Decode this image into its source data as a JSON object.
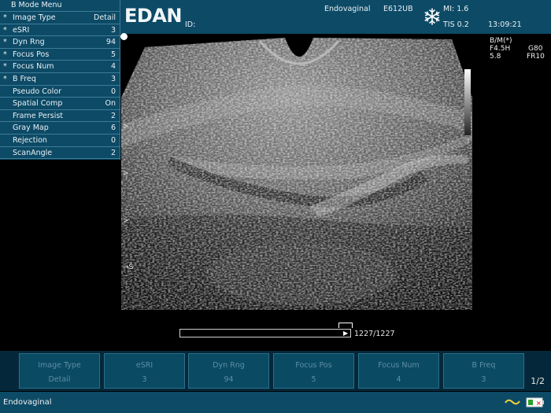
{
  "menu": {
    "title": "B Mode Menu",
    "items": [
      {
        "star": "*",
        "label": "Image Type",
        "value": "Detail"
      },
      {
        "star": "*",
        "label": "eSRI",
        "value": "3"
      },
      {
        "star": "*",
        "label": "Dyn Rng",
        "value": "94"
      },
      {
        "star": "*",
        "label": "Focus Pos",
        "value": "5"
      },
      {
        "star": "*",
        "label": "Focus Num",
        "value": "4"
      },
      {
        "star": "*",
        "label": "B Freq",
        "value": "3"
      },
      {
        "star": "",
        "label": "Pseudo Color",
        "value": "0"
      },
      {
        "star": "",
        "label": "Spatial Comp",
        "value": "On"
      },
      {
        "star": "",
        "label": "Frame Persist",
        "value": "2"
      },
      {
        "star": "",
        "label": "Gray Map",
        "value": "6"
      },
      {
        "star": "",
        "label": "Rejection",
        "value": "0"
      },
      {
        "star": "",
        "label": "ScanAngle",
        "value": "2"
      }
    ]
  },
  "header": {
    "logo": "EDAN",
    "id_label": "ID:",
    "probe_mode": "Endovaginal",
    "probe_name": "E612UB",
    "freeze_icon": "snowflake-icon",
    "mi": "MI: 1.6",
    "tis": "TIS 0.2",
    "time": "13:09:21"
  },
  "params": {
    "mode": "B/M(*)",
    "freq": "F4.5H",
    "gain": "G80",
    "depth": "5.8",
    "frame_rate": "FR10"
  },
  "depth_markers": [
    ">",
    ">",
    ">",
    "→S"
  ],
  "cine": {
    "frame": "1227/1227",
    "progress": 1.0
  },
  "softkeys": [
    {
      "label": "Image Type",
      "value": "Detail"
    },
    {
      "label": "eSRI",
      "value": "3"
    },
    {
      "label": "Dyn Rng",
      "value": "94"
    },
    {
      "label": "Focus Pos",
      "value": "5"
    },
    {
      "label": "Focus Num",
      "value": "4"
    },
    {
      "label": "B Freq",
      "value": "3"
    }
  ],
  "page_indicator": "1/2",
  "status": {
    "text": "Endovaginal",
    "icons": [
      "wave-icon",
      "battery-icon"
    ]
  }
}
